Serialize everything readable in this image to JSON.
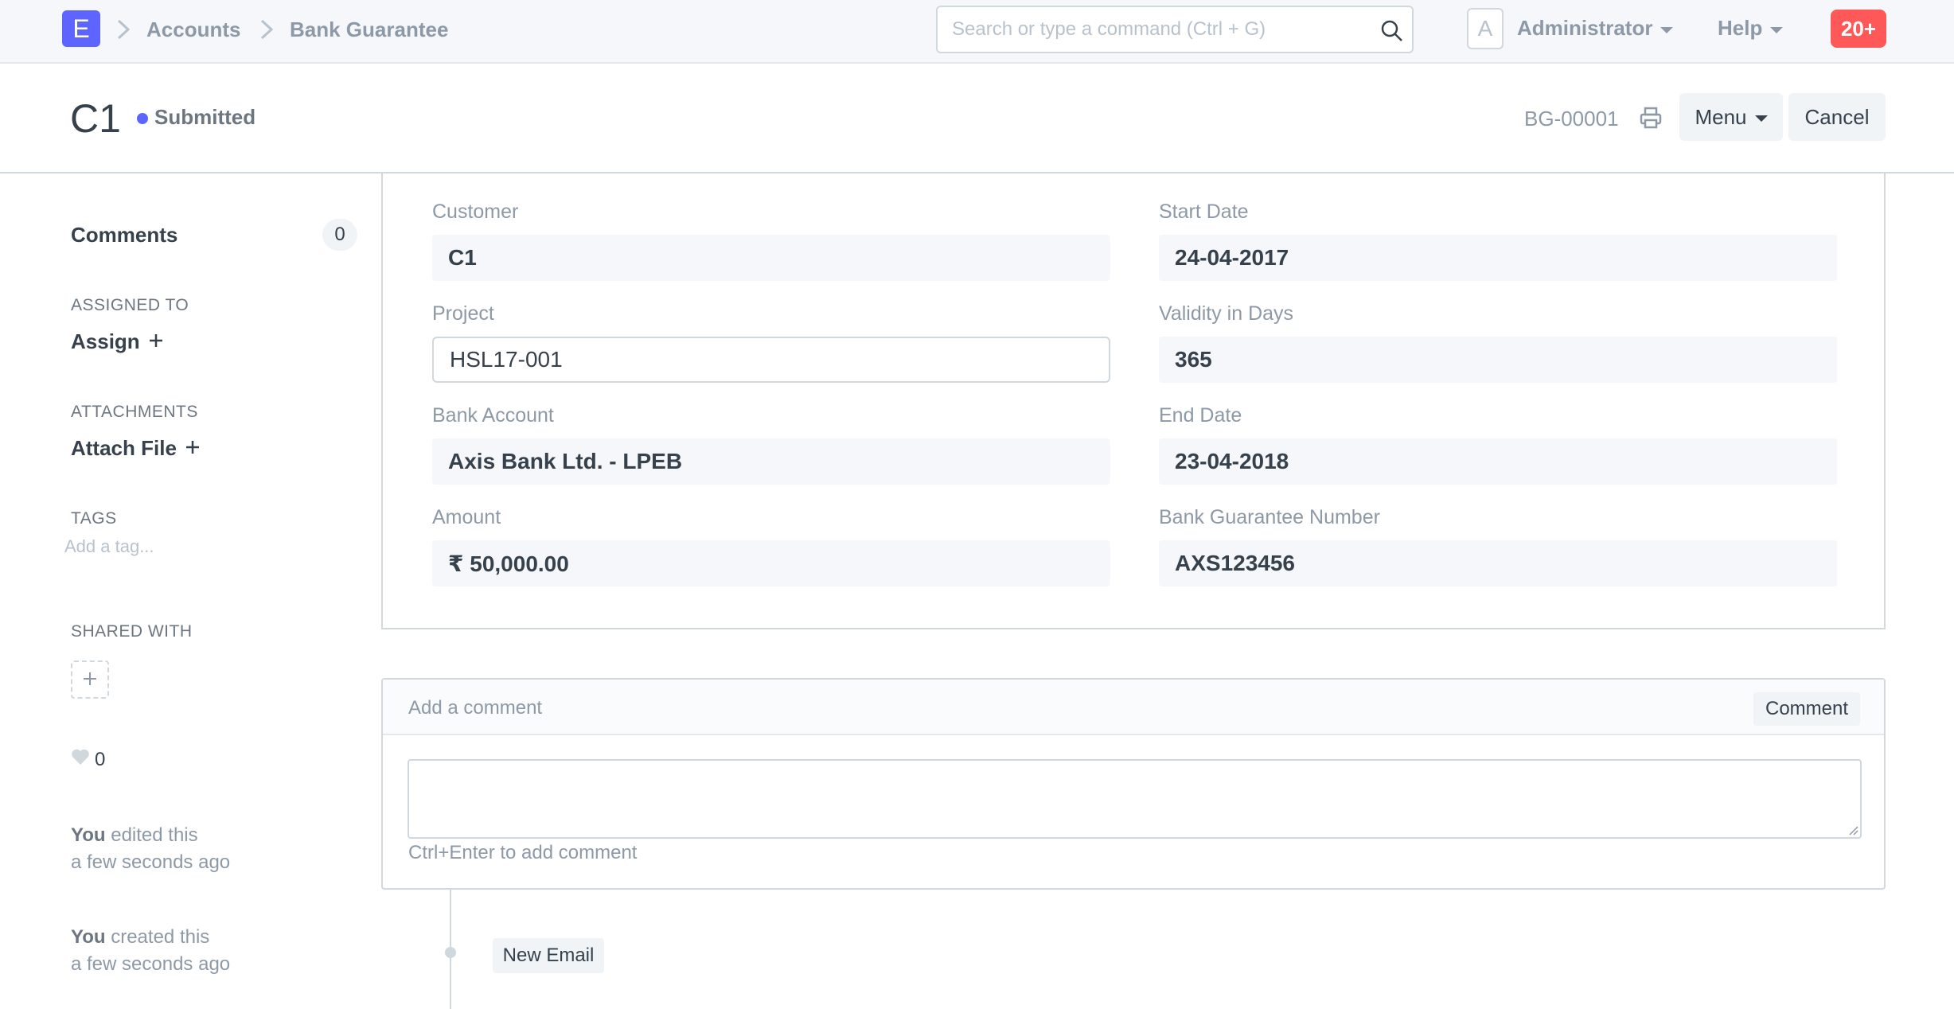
{
  "navbar": {
    "logo_letter": "E",
    "breadcrumbs": [
      "Accounts",
      "Bank Guarantee"
    ],
    "search_placeholder": "Search or type a command (Ctrl + G)",
    "avatar_letter": "A",
    "user_label": "Administrator",
    "help_label": "Help",
    "notification_count": "20+"
  },
  "page_head": {
    "title": "C1",
    "status": "Submitted",
    "doc_name": "BG-00001",
    "menu_label": "Menu",
    "cancel_label": "Cancel"
  },
  "sidebar": {
    "comments_label": "Comments",
    "comments_count": "0",
    "assigned_to_heading": "ASSIGNED TO",
    "assign_label": "Assign",
    "attachments_heading": "ATTACHMENTS",
    "attach_label": "Attach File",
    "tags_heading": "TAGS",
    "tag_placeholder": "Add a tag...",
    "shared_with_heading": "SHARED WITH",
    "likes_count": "0",
    "activity": [
      {
        "actor": "You",
        "action": "edited this",
        "time": "a few seconds ago"
      },
      {
        "actor": "You",
        "action": "created this",
        "time": "a few seconds ago"
      }
    ]
  },
  "form": {
    "customer_label": "Customer",
    "customer_value": "C1",
    "project_label": "Project",
    "project_value": "HSL17-001",
    "bank_account_label": "Bank Account",
    "bank_account_value": "Axis Bank Ltd. - LPEB",
    "amount_label": "Amount",
    "amount_value": "₹ 50,000.00",
    "start_date_label": "Start Date",
    "start_date_value": "24-04-2017",
    "validity_label": "Validity in Days",
    "validity_value": "365",
    "end_date_label": "End Date",
    "end_date_value": "23-04-2018",
    "bg_number_label": "Bank Guarantee Number",
    "bg_number_value": "AXS123456"
  },
  "comment_box": {
    "heading": "Add a comment",
    "button_label": "Comment",
    "hint": "Ctrl+Enter to add comment"
  },
  "timeline": {
    "new_email_label": "New Email"
  },
  "colors": {
    "primary": "#5e64ff",
    "notification": "#ff5858",
    "text": "#36414c",
    "muted": "#8d99a6",
    "field_bg": "#f5f7fa",
    "border": "#d1d8dd"
  }
}
